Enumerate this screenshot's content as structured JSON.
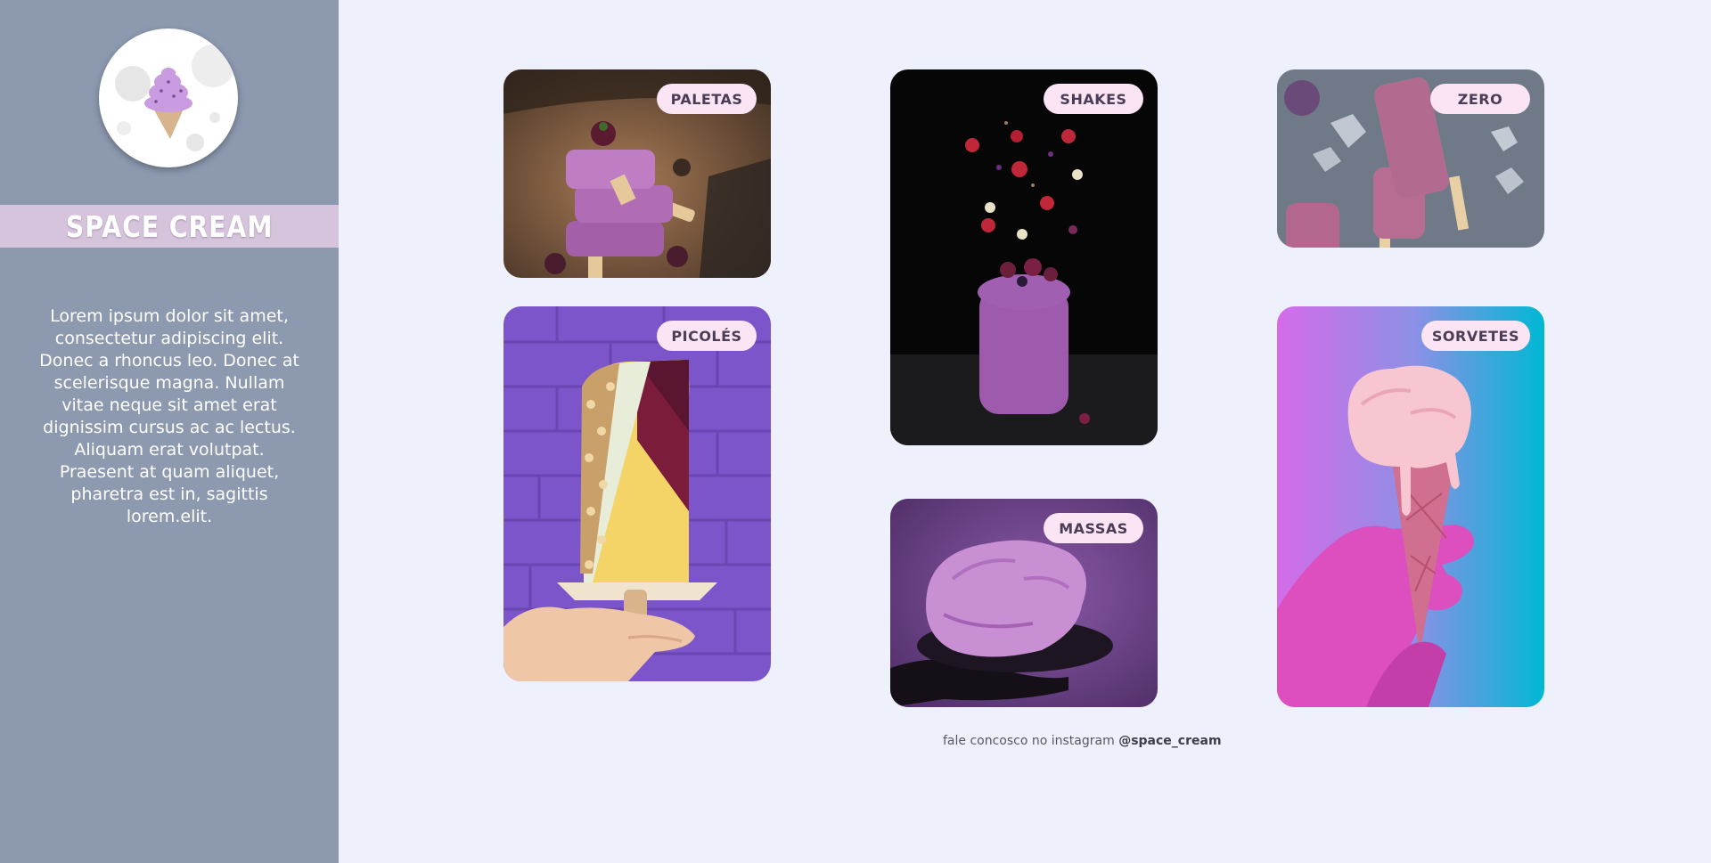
{
  "sidebar": {
    "brand": "SPACE CREAM",
    "description": "Lorem ipsum dolor sit amet, consectetur adipiscing elit. Donec a rhoncus leo. Donec at scelerisque magna. Nullam vitae neque sit amet erat dignissim cursus ac ac lectus. Aliquam erat volutpat. Praesent at quam aliquet, pharetra est in, sagittis lorem.elit.",
    "logo_icon": "ice-cream-cone-icon"
  },
  "cards": {
    "paletas": "PALETAS",
    "shakes": "SHAKES",
    "zero": "ZERO",
    "picoles": "PICOLÉS",
    "massas": "MASSAS",
    "sorvetes": "SORVETES"
  },
  "footer": {
    "text": "fale concosco no instagram ",
    "handle": "@space_cream"
  },
  "colors": {
    "page_bg": "#eef0fb",
    "sidebar_bg": "#8c99af",
    "brand_band": "#d6c3dc",
    "tag_bg": "#fbe5f4",
    "tag_text": "#4a3d55"
  }
}
